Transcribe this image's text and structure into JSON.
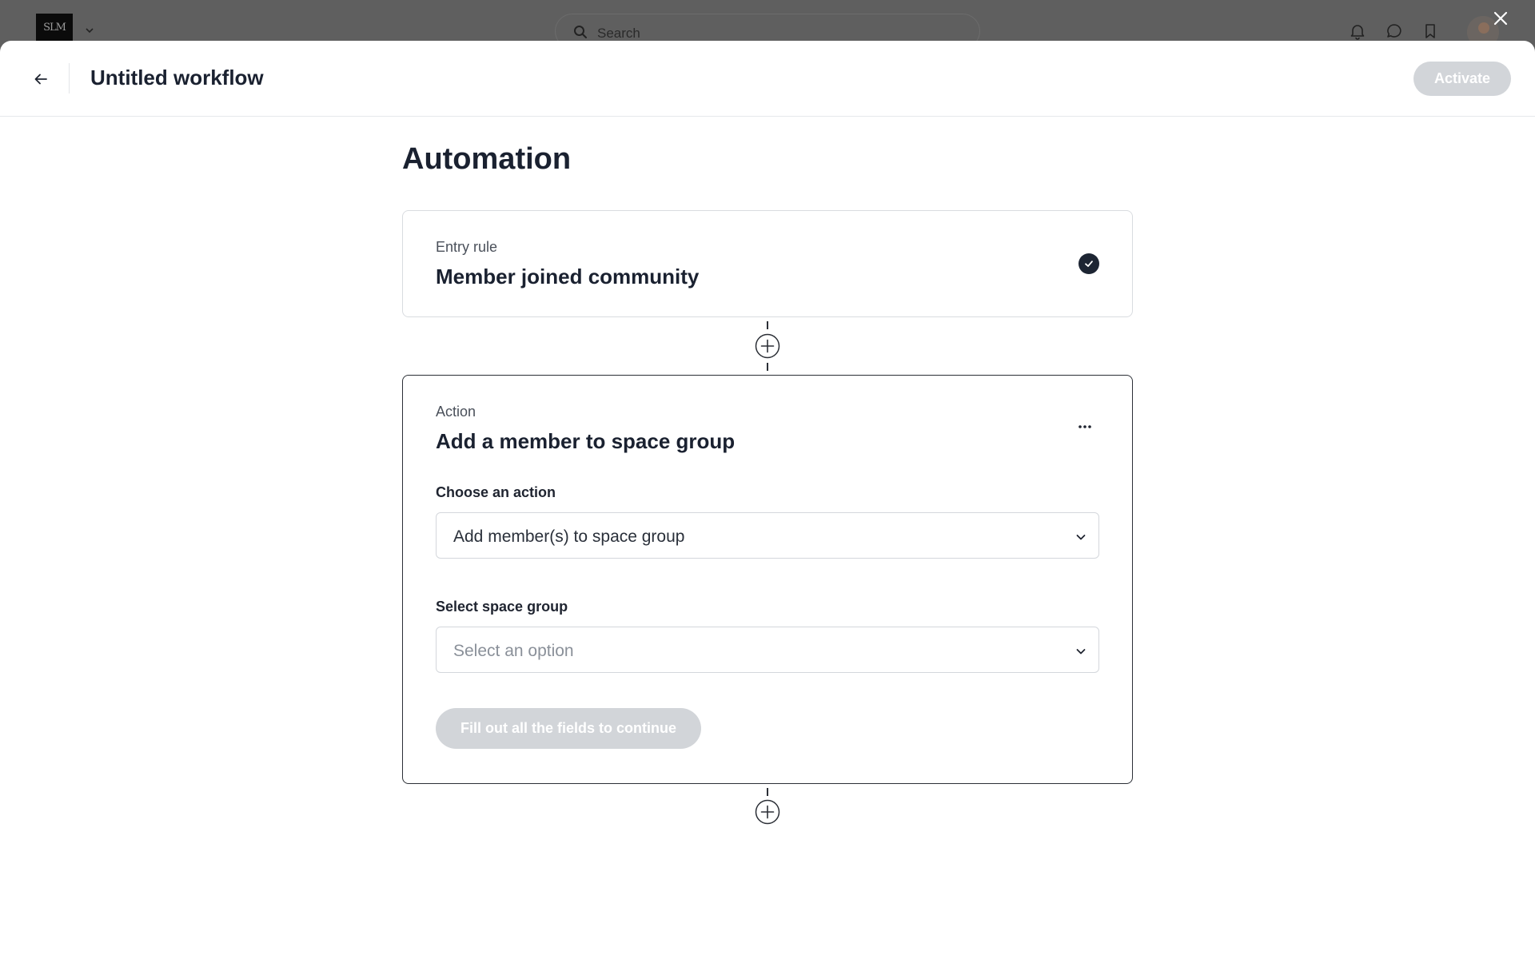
{
  "app_bar": {
    "logo_text": "SLM",
    "search_placeholder": "Search"
  },
  "header": {
    "title": "Untitled workflow",
    "activate_label": "Activate"
  },
  "page": {
    "heading": "Automation"
  },
  "entry_rule": {
    "kicker": "Entry rule",
    "title": "Member joined community",
    "status": "complete"
  },
  "action": {
    "kicker": "Action",
    "title": "Add a member to space group",
    "choose_action_label": "Choose an action",
    "choose_action_value": "Add member(s) to space group",
    "space_group_label": "Select space group",
    "space_group_placeholder": "Select an option",
    "continue_label": "Fill out all the fields to continue"
  },
  "colors": {
    "accent_dark": "#1d2533",
    "disabled_button": "#d2d5d9",
    "overlay": "#5f5f5f"
  }
}
